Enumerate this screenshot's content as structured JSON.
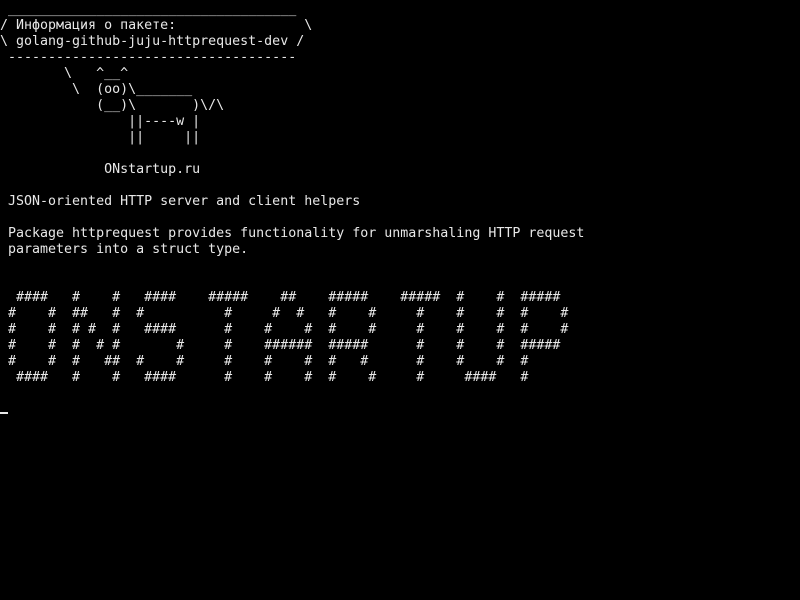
{
  "terminal": {
    "bubble": {
      "top_border": " ____________________________________",
      "line1": "/ Информация о пакете:                \\",
      "line2": "\\ golang-github-juju-httprequest-dev /",
      "bottom_border": " ------------------------------------"
    },
    "cow": {
      "line1": "        \\   ^__^",
      "line2": "         \\  (oo)\\_______",
      "line3": "            (__)\\       )\\/\\",
      "line4": "                ||----w |",
      "line5": "                ||     ||"
    },
    "site": "             ONstartup.ru",
    "description": " JSON-oriented HTTP server and client helpers",
    "package_info": {
      "line1": " Package httprequest provides functionality for unmarshaling HTTP request",
      "line2": " parameters into a struct type."
    },
    "banner": [
      "  ####   #    #   ####    #####    ##    #####    #####  #    #  #####",
      " #    #  ##   #  #          #     #  #   #    #     #    #    #  #    #",
      " #    #  # #  #   ####      #    #    #  #    #     #    #    #  #    #",
      " #    #  #  # #       #     #    ######  #####      #    #    #  #####",
      " #    #  #   ##  #    #     #    #    #  #   #      #    #    #  #",
      "  ####   #    #   ####      #    #    #  #    #     #     ####   #"
    ],
    "colors": {
      "background": "#000000",
      "foreground": "#e8e8e8"
    }
  }
}
